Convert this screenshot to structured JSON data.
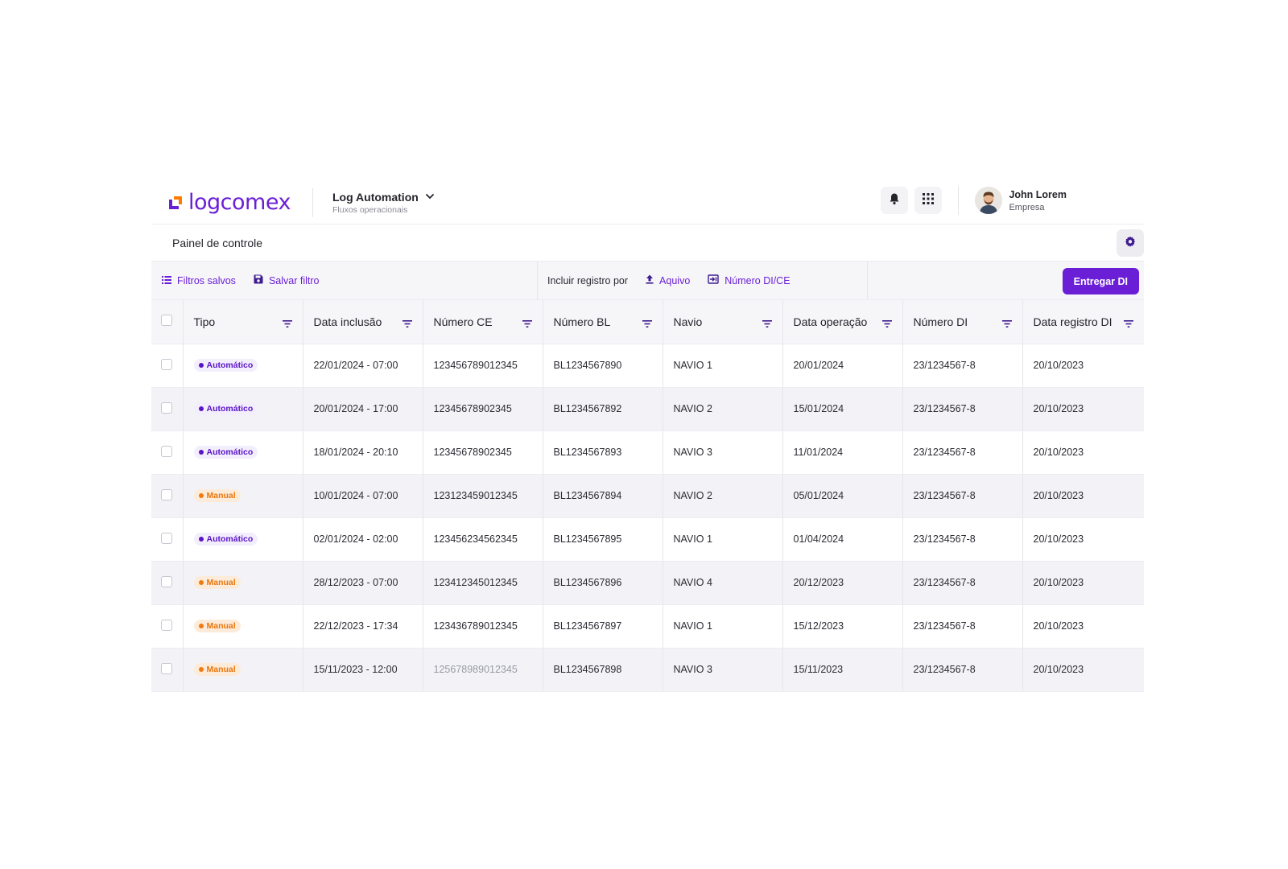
{
  "header": {
    "logo_text": "logcomex",
    "product_title": "Log Automation",
    "product_subtitle": "Fluxos operacionais",
    "user_name": "John Lorem",
    "user_company": "Empresa",
    "icons": [
      "bell-icon",
      "apps-grid-icon",
      "chevron-down-icon"
    ]
  },
  "panel": {
    "title": "Painel de controle"
  },
  "toolbar": {
    "saved_filters": "Filtros salvos",
    "save_filter": "Salvar filtro",
    "include_label": "Incluir registro por",
    "file_link": "Aquivo",
    "number_link": "Número DI/CE",
    "primary_button": "Entregar DI"
  },
  "colors": {
    "brand": "#6a1fd6",
    "auto_badge": "#5a14c6",
    "manual_badge": "#f07a10"
  },
  "table": {
    "columns": [
      "Tipo",
      "Data inclusão",
      "Número CE",
      "Número BL",
      "Navio",
      "Data operação",
      "Número DI",
      "Data registro DI"
    ],
    "rows": [
      {
        "tipo": "Automático",
        "kind": "auto",
        "data_inclusao": "22/01/2024 - 07:00",
        "numero_ce": "123456789012345",
        "numero_bl": "BL1234567890",
        "navio": "NAVIO 1",
        "data_operacao": "20/01/2024",
        "numero_di": "23/1234567-8",
        "data_registro_di": "20/10/2023"
      },
      {
        "tipo": "Automático",
        "kind": "auto",
        "data_inclusao": "20/01/2024 - 17:00",
        "numero_ce": "12345678902345",
        "numero_bl": "BL1234567892",
        "navio": "NAVIO 2",
        "data_operacao": "15/01/2024",
        "numero_di": "23/1234567-8",
        "data_registro_di": "20/10/2023"
      },
      {
        "tipo": "Automático",
        "kind": "auto",
        "data_inclusao": "18/01/2024 - 20:10",
        "numero_ce": "12345678902345",
        "numero_bl": "BL1234567893",
        "navio": "NAVIO 3",
        "data_operacao": "11/01/2024",
        "numero_di": "23/1234567-8",
        "data_registro_di": "20/10/2023"
      },
      {
        "tipo": "Manual",
        "kind": "manual",
        "data_inclusao": "10/01/2024 - 07:00",
        "numero_ce": "123123459012345",
        "numero_bl": "BL1234567894",
        "navio": "NAVIO 2",
        "data_operacao": "05/01/2024",
        "numero_di": "23/1234567-8",
        "data_registro_di": "20/10/2023"
      },
      {
        "tipo": "Automático",
        "kind": "auto",
        "data_inclusao": "02/01/2024 - 02:00",
        "numero_ce": "123456234562345",
        "numero_bl": "BL1234567895",
        "navio": "NAVIO 1",
        "data_operacao": "01/04/2024",
        "numero_di": "23/1234567-8",
        "data_registro_di": "20/10/2023"
      },
      {
        "tipo": "Manual",
        "kind": "manual",
        "data_inclusao": "28/12/2023 - 07:00",
        "numero_ce": "123412345012345",
        "numero_bl": "BL1234567896",
        "navio": "NAVIO 4",
        "data_operacao": "20/12/2023",
        "numero_di": "23/1234567-8",
        "data_registro_di": "20/10/2023"
      },
      {
        "tipo": "Manual",
        "kind": "manual",
        "data_inclusao": "22/12/2023 - 17:34",
        "numero_ce": "123436789012345",
        "numero_bl": "BL1234567897",
        "navio": "NAVIO 1",
        "data_operacao": "15/12/2023",
        "numero_di": "23/1234567-8",
        "data_registro_di": "20/10/2023"
      },
      {
        "tipo": "Manual",
        "kind": "manual",
        "data_inclusao": "15/11/2023 - 12:00",
        "numero_ce": "125678989012345",
        "numero_bl": "BL1234567898",
        "navio": "NAVIO 3",
        "data_operacao": "15/11/2023",
        "numero_di": "23/1234567-8",
        "data_registro_di": "20/10/2023"
      }
    ]
  }
}
